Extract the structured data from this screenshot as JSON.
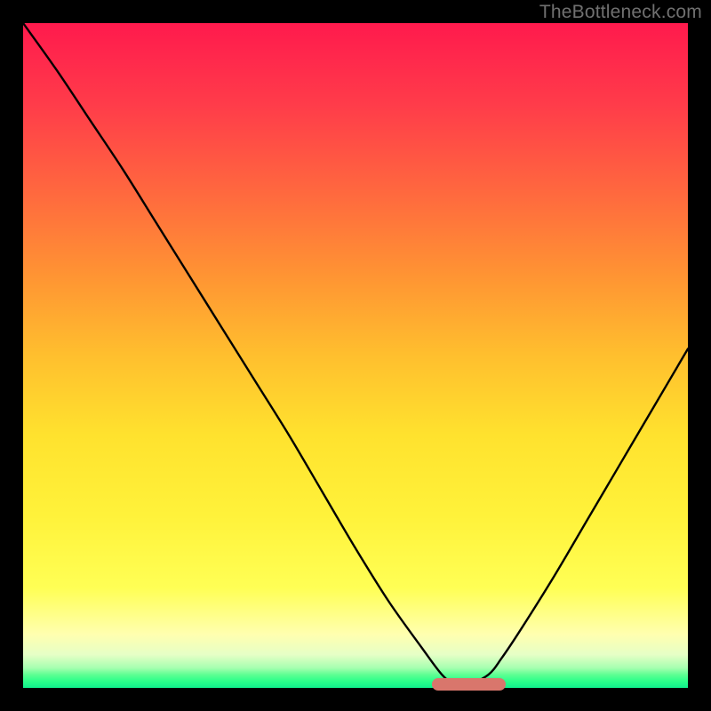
{
  "watermark": "TheBottleneck.com",
  "chart_data": {
    "type": "line",
    "title": "",
    "xlabel": "",
    "ylabel": "",
    "xlim": [
      0,
      100
    ],
    "ylim": [
      0,
      100
    ],
    "grid": false,
    "legend": false,
    "x": [
      0,
      5,
      10,
      15,
      20,
      25,
      30,
      35,
      40,
      45,
      50,
      55,
      60,
      63,
      65,
      67,
      70,
      72,
      75,
      80,
      85,
      90,
      95,
      100
    ],
    "values": [
      100,
      93,
      85.5,
      78,
      70,
      62,
      54,
      46,
      38,
      29.5,
      21,
      13,
      6,
      2,
      0.5,
      0.5,
      2,
      4.5,
      9,
      17,
      25.5,
      34,
      42.5,
      51
    ],
    "min_band": {
      "x_start": 62,
      "x_end": 72,
      "y": 0.5
    }
  },
  "colors": {
    "frame": "#000000",
    "gradient_top": "#ff1a4d",
    "gradient_bottom": "#10f08c",
    "curve": "#000000",
    "salmon": "#d9766c",
    "watermark": "#707070"
  }
}
